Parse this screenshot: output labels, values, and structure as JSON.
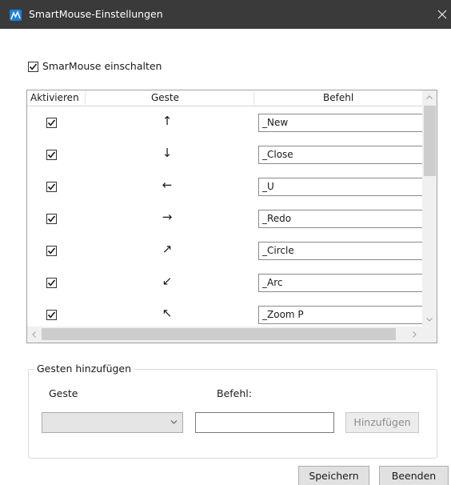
{
  "window": {
    "title": "SmartMouse-Einstellungen",
    "close_icon": "close-icon"
  },
  "main_toggle": {
    "label": "SmarMouse einschalten",
    "checked": true
  },
  "grid": {
    "columns": [
      "Aktivieren",
      "Geste",
      "Befehl"
    ],
    "rows": [
      {
        "enabled": true,
        "gesture": "↑",
        "command": "_New"
      },
      {
        "enabled": true,
        "gesture": "↓",
        "command": "_Close"
      },
      {
        "enabled": true,
        "gesture": "←",
        "command": "_U"
      },
      {
        "enabled": true,
        "gesture": "→",
        "command": "_Redo"
      },
      {
        "enabled": true,
        "gesture": "↗",
        "command": "_Circle"
      },
      {
        "enabled": true,
        "gesture": "↙",
        "command": "_Arc"
      },
      {
        "enabled": true,
        "gesture": "↖",
        "command": "_Zoom P"
      }
    ]
  },
  "add_group": {
    "legend": "Gesten hinzufügen",
    "gesture_label": "Geste",
    "command_label": "Befehl:",
    "gesture_value": "",
    "command_value": "",
    "add_button": "Hinzufügen",
    "add_button_enabled": false
  },
  "footer": {
    "save_button": "Speichern",
    "exit_button": "Beenden"
  },
  "colors": {
    "titlebar": "#3a3a3a",
    "app_icon": "#1e7fd8"
  }
}
